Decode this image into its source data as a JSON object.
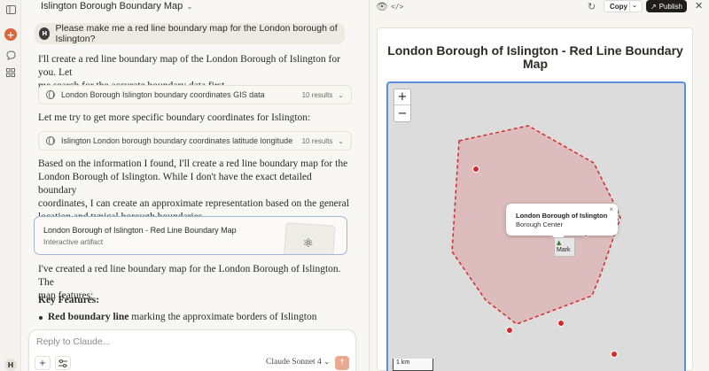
{
  "rail": {
    "avatar_initial": "H",
    "icons": [
      "sidebar-toggle-icon",
      "new-chat-icon",
      "chats-icon",
      "projects-icon"
    ]
  },
  "chat": {
    "title": "Islington Borough Boundary Map",
    "user_initial": "H",
    "user_message": "Please make me a red line boundary map for the London borough of Islington?",
    "para1_line1": "I'll create a red line boundary map of the London Borough of Islington for you. Let",
    "para1_line2": "me search for the accurate boundary data first.",
    "search1": {
      "label": "London Borough Islington boundary coordinates GIS data",
      "count": "10 results"
    },
    "para2": "Let me try to get more specific boundary coordinates for Islington:",
    "search2": {
      "label": "Islington London borough boundary coordinates latitude longitude",
      "count": "10 results"
    },
    "para3_l1": "Based on the information I found, I'll create a red line boundary map for the",
    "para3_l2": "London Borough of Islington. While I don't have the exact detailed boundary",
    "para3_l3": "coordinates, I can create an approximate representation based on the general",
    "para3_l4": "location and typical borough boundaries.",
    "artifact": {
      "title": "London Borough of Islington - Red Line Boundary Map",
      "subtitle": "Interactive artifact"
    },
    "para4_l1": "I've created a red line boundary map for the London Borough of Islington. The",
    "para4_l2": "map features:",
    "key_features": "Key Features:",
    "bullet_bold": "Red boundary line",
    "bullet_rest": " marking the approximate borders of Islington",
    "composer": {
      "placeholder": "Reply to Claude...",
      "model": "Claude Sonnet 4"
    }
  },
  "toolbar": {
    "copy_label": "Copy",
    "publish_label": "Publish"
  },
  "artifact_view": {
    "title_line1": "London Borough of Islington - Red Line Boundary",
    "title_line2": "Map",
    "zoom_in": "+",
    "zoom_out": "−",
    "popup_title": "London Borough of Islington",
    "popup_subtitle": "Borough Center",
    "popup_close": "×",
    "marker_label": "Mark",
    "scale_label": "1 km",
    "boundary_color": "#d42a2a",
    "fill_color": "#dcbcbc",
    "accent_color": "#d8653b"
  }
}
